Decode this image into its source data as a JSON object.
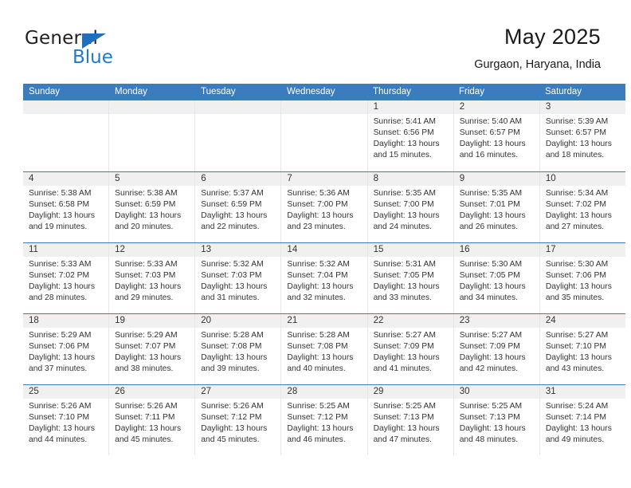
{
  "brand": {
    "name_top": "General",
    "name_bottom": "Blue",
    "triangle_color": "#1e6fc0",
    "blue_color": "#1e7ad0"
  },
  "header": {
    "title": "May 2025",
    "subtitle": "Gurgaon, Haryana, India"
  },
  "theme": {
    "header_bar_color": "#3a7cbe",
    "day_band_color": "#f0f0f0",
    "text_color": "#333333"
  },
  "calendar": {
    "weekdays": [
      "Sunday",
      "Monday",
      "Tuesday",
      "Wednesday",
      "Thursday",
      "Friday",
      "Saturday"
    ],
    "weeks": [
      [
        {
          "day": "",
          "lines": []
        },
        {
          "day": "",
          "lines": []
        },
        {
          "day": "",
          "lines": []
        },
        {
          "day": "",
          "lines": []
        },
        {
          "day": "1",
          "lines": [
            "Sunrise: 5:41 AM",
            "Sunset: 6:56 PM",
            "Daylight: 13 hours",
            "and 15 minutes."
          ]
        },
        {
          "day": "2",
          "lines": [
            "Sunrise: 5:40 AM",
            "Sunset: 6:57 PM",
            "Daylight: 13 hours",
            "and 16 minutes."
          ]
        },
        {
          "day": "3",
          "lines": [
            "Sunrise: 5:39 AM",
            "Sunset: 6:57 PM",
            "Daylight: 13 hours",
            "and 18 minutes."
          ]
        }
      ],
      [
        {
          "day": "4",
          "lines": [
            "Sunrise: 5:38 AM",
            "Sunset: 6:58 PM",
            "Daylight: 13 hours",
            "and 19 minutes."
          ]
        },
        {
          "day": "5",
          "lines": [
            "Sunrise: 5:38 AM",
            "Sunset: 6:59 PM",
            "Daylight: 13 hours",
            "and 20 minutes."
          ]
        },
        {
          "day": "6",
          "lines": [
            "Sunrise: 5:37 AM",
            "Sunset: 6:59 PM",
            "Daylight: 13 hours",
            "and 22 minutes."
          ]
        },
        {
          "day": "7",
          "lines": [
            "Sunrise: 5:36 AM",
            "Sunset: 7:00 PM",
            "Daylight: 13 hours",
            "and 23 minutes."
          ]
        },
        {
          "day": "8",
          "lines": [
            "Sunrise: 5:35 AM",
            "Sunset: 7:00 PM",
            "Daylight: 13 hours",
            "and 24 minutes."
          ]
        },
        {
          "day": "9",
          "lines": [
            "Sunrise: 5:35 AM",
            "Sunset: 7:01 PM",
            "Daylight: 13 hours",
            "and 26 minutes."
          ]
        },
        {
          "day": "10",
          "lines": [
            "Sunrise: 5:34 AM",
            "Sunset: 7:02 PM",
            "Daylight: 13 hours",
            "and 27 minutes."
          ]
        }
      ],
      [
        {
          "day": "11",
          "lines": [
            "Sunrise: 5:33 AM",
            "Sunset: 7:02 PM",
            "Daylight: 13 hours",
            "and 28 minutes."
          ]
        },
        {
          "day": "12",
          "lines": [
            "Sunrise: 5:33 AM",
            "Sunset: 7:03 PM",
            "Daylight: 13 hours",
            "and 29 minutes."
          ]
        },
        {
          "day": "13",
          "lines": [
            "Sunrise: 5:32 AM",
            "Sunset: 7:03 PM",
            "Daylight: 13 hours",
            "and 31 minutes."
          ]
        },
        {
          "day": "14",
          "lines": [
            "Sunrise: 5:32 AM",
            "Sunset: 7:04 PM",
            "Daylight: 13 hours",
            "and 32 minutes."
          ]
        },
        {
          "day": "15",
          "lines": [
            "Sunrise: 5:31 AM",
            "Sunset: 7:05 PM",
            "Daylight: 13 hours",
            "and 33 minutes."
          ]
        },
        {
          "day": "16",
          "lines": [
            "Sunrise: 5:30 AM",
            "Sunset: 7:05 PM",
            "Daylight: 13 hours",
            "and 34 minutes."
          ]
        },
        {
          "day": "17",
          "lines": [
            "Sunrise: 5:30 AM",
            "Sunset: 7:06 PM",
            "Daylight: 13 hours",
            "and 35 minutes."
          ]
        }
      ],
      [
        {
          "day": "18",
          "lines": [
            "Sunrise: 5:29 AM",
            "Sunset: 7:06 PM",
            "Daylight: 13 hours",
            "and 37 minutes."
          ]
        },
        {
          "day": "19",
          "lines": [
            "Sunrise: 5:29 AM",
            "Sunset: 7:07 PM",
            "Daylight: 13 hours",
            "and 38 minutes."
          ]
        },
        {
          "day": "20",
          "lines": [
            "Sunrise: 5:28 AM",
            "Sunset: 7:08 PM",
            "Daylight: 13 hours",
            "and 39 minutes."
          ]
        },
        {
          "day": "21",
          "lines": [
            "Sunrise: 5:28 AM",
            "Sunset: 7:08 PM",
            "Daylight: 13 hours",
            "and 40 minutes."
          ]
        },
        {
          "day": "22",
          "lines": [
            "Sunrise: 5:27 AM",
            "Sunset: 7:09 PM",
            "Daylight: 13 hours",
            "and 41 minutes."
          ]
        },
        {
          "day": "23",
          "lines": [
            "Sunrise: 5:27 AM",
            "Sunset: 7:09 PM",
            "Daylight: 13 hours",
            "and 42 minutes."
          ]
        },
        {
          "day": "24",
          "lines": [
            "Sunrise: 5:27 AM",
            "Sunset: 7:10 PM",
            "Daylight: 13 hours",
            "and 43 minutes."
          ]
        }
      ],
      [
        {
          "day": "25",
          "lines": [
            "Sunrise: 5:26 AM",
            "Sunset: 7:10 PM",
            "Daylight: 13 hours",
            "and 44 minutes."
          ]
        },
        {
          "day": "26",
          "lines": [
            "Sunrise: 5:26 AM",
            "Sunset: 7:11 PM",
            "Daylight: 13 hours",
            "and 45 minutes."
          ]
        },
        {
          "day": "27",
          "lines": [
            "Sunrise: 5:26 AM",
            "Sunset: 7:12 PM",
            "Daylight: 13 hours",
            "and 45 minutes."
          ]
        },
        {
          "day": "28",
          "lines": [
            "Sunrise: 5:25 AM",
            "Sunset: 7:12 PM",
            "Daylight: 13 hours",
            "and 46 minutes."
          ]
        },
        {
          "day": "29",
          "lines": [
            "Sunrise: 5:25 AM",
            "Sunset: 7:13 PM",
            "Daylight: 13 hours",
            "and 47 minutes."
          ]
        },
        {
          "day": "30",
          "lines": [
            "Sunrise: 5:25 AM",
            "Sunset: 7:13 PM",
            "Daylight: 13 hours",
            "and 48 minutes."
          ]
        },
        {
          "day": "31",
          "lines": [
            "Sunrise: 5:24 AM",
            "Sunset: 7:14 PM",
            "Daylight: 13 hours",
            "and 49 minutes."
          ]
        }
      ]
    ]
  }
}
